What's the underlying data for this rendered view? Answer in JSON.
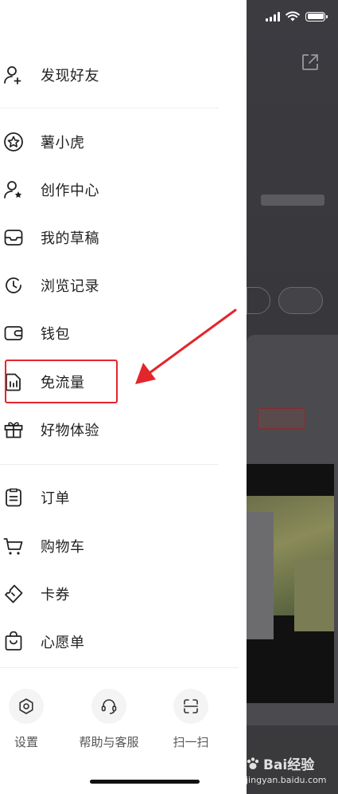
{
  "colors": {
    "accent": "#e3262c",
    "text": "#222222",
    "muted": "#555555",
    "divider": "#ededed",
    "backdrop": "#3a3a3e"
  },
  "status_bar": {
    "icons": [
      "signal-icon",
      "wifi-icon",
      "battery-icon"
    ]
  },
  "drawer": {
    "menu_groups": [
      [
        {
          "label": "发现好友",
          "icon": "add-friend-icon"
        }
      ],
      [
        {
          "label": "薯小虎",
          "icon": "star-badge-icon"
        },
        {
          "label": "创作中心",
          "icon": "creator-icon"
        },
        {
          "label": "我的草稿",
          "icon": "drafts-icon"
        },
        {
          "label": "浏览记录",
          "icon": "history-icon"
        },
        {
          "label": "钱包",
          "icon": "wallet-icon"
        },
        {
          "label": "免流量",
          "icon": "data-free-icon"
        },
        {
          "label": "好物体验",
          "icon": "gift-icon"
        }
      ],
      [
        {
          "label": "订单",
          "icon": "order-icon"
        },
        {
          "label": "购物车",
          "icon": "cart-icon"
        },
        {
          "label": "卡券",
          "icon": "coupon-icon"
        },
        {
          "label": "心愿单",
          "icon": "wishlist-icon"
        }
      ]
    ],
    "footer": [
      {
        "label": "设置",
        "icon": "settings-icon"
      },
      {
        "label": "帮助与客服",
        "icon": "headset-icon"
      },
      {
        "label": "扫一扫",
        "icon": "scan-icon"
      }
    ]
  },
  "annotation": {
    "highlighted_item": "免流量",
    "color": "#e3262c"
  },
  "watermark": {
    "brand": "Bai经验",
    "url": "jingyan.baidu.com"
  }
}
